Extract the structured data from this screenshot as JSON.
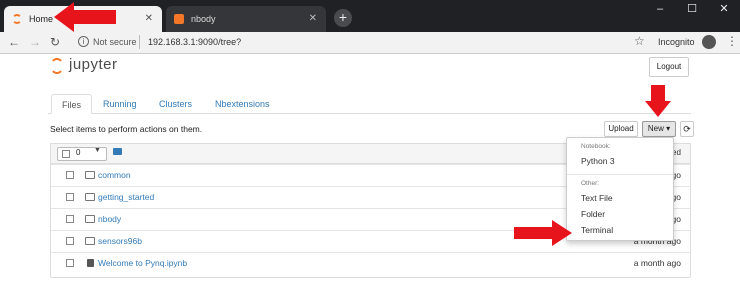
{
  "browser": {
    "tabs": [
      {
        "label": "Home",
        "active": true
      },
      {
        "label": "nbody",
        "active": false
      }
    ],
    "close_glyph": "✕",
    "new_tab_glyph": "+",
    "window_controls": [
      "–",
      "☐",
      "✕"
    ],
    "security_text": "Not secure",
    "url": "192.168.3.1:9090/tree?",
    "profile_label": "Incognito"
  },
  "jupyter": {
    "logo_text": "jupyter",
    "logout_label": "Logout",
    "tabs": [
      "Files",
      "Running",
      "Clusters",
      "Nbextensions"
    ],
    "toolbar": {
      "instructions": "Select items to perform actions on them.",
      "upload_label": "Upload",
      "new_label": "New ▾",
      "refresh_glyph": "⟳"
    },
    "list_header": {
      "selected_count": "0",
      "modified_partial": "ed"
    },
    "rows": [
      {
        "name": "common",
        "time": "ago",
        "kind": "folder"
      },
      {
        "name": "getting_started",
        "time": "ago",
        "kind": "folder"
      },
      {
        "name": "nbody",
        "time": "ago",
        "kind": "folder"
      },
      {
        "name": "sensors96b",
        "time": "a month ago",
        "kind": "folder"
      },
      {
        "name": "Welcome to Pynq.ipynb",
        "time": "a month ago",
        "kind": "notebook"
      }
    ],
    "new_menu": {
      "notebook_header": "Notebook:",
      "notebook_items": [
        "Python 3"
      ],
      "other_header": "Other:",
      "other_items": [
        "Text File",
        "Folder",
        "Terminal"
      ]
    }
  },
  "colors": {
    "accent_red": "#e8141c",
    "jupyter_orange": "#f37726",
    "link_blue": "#337ab7"
  }
}
